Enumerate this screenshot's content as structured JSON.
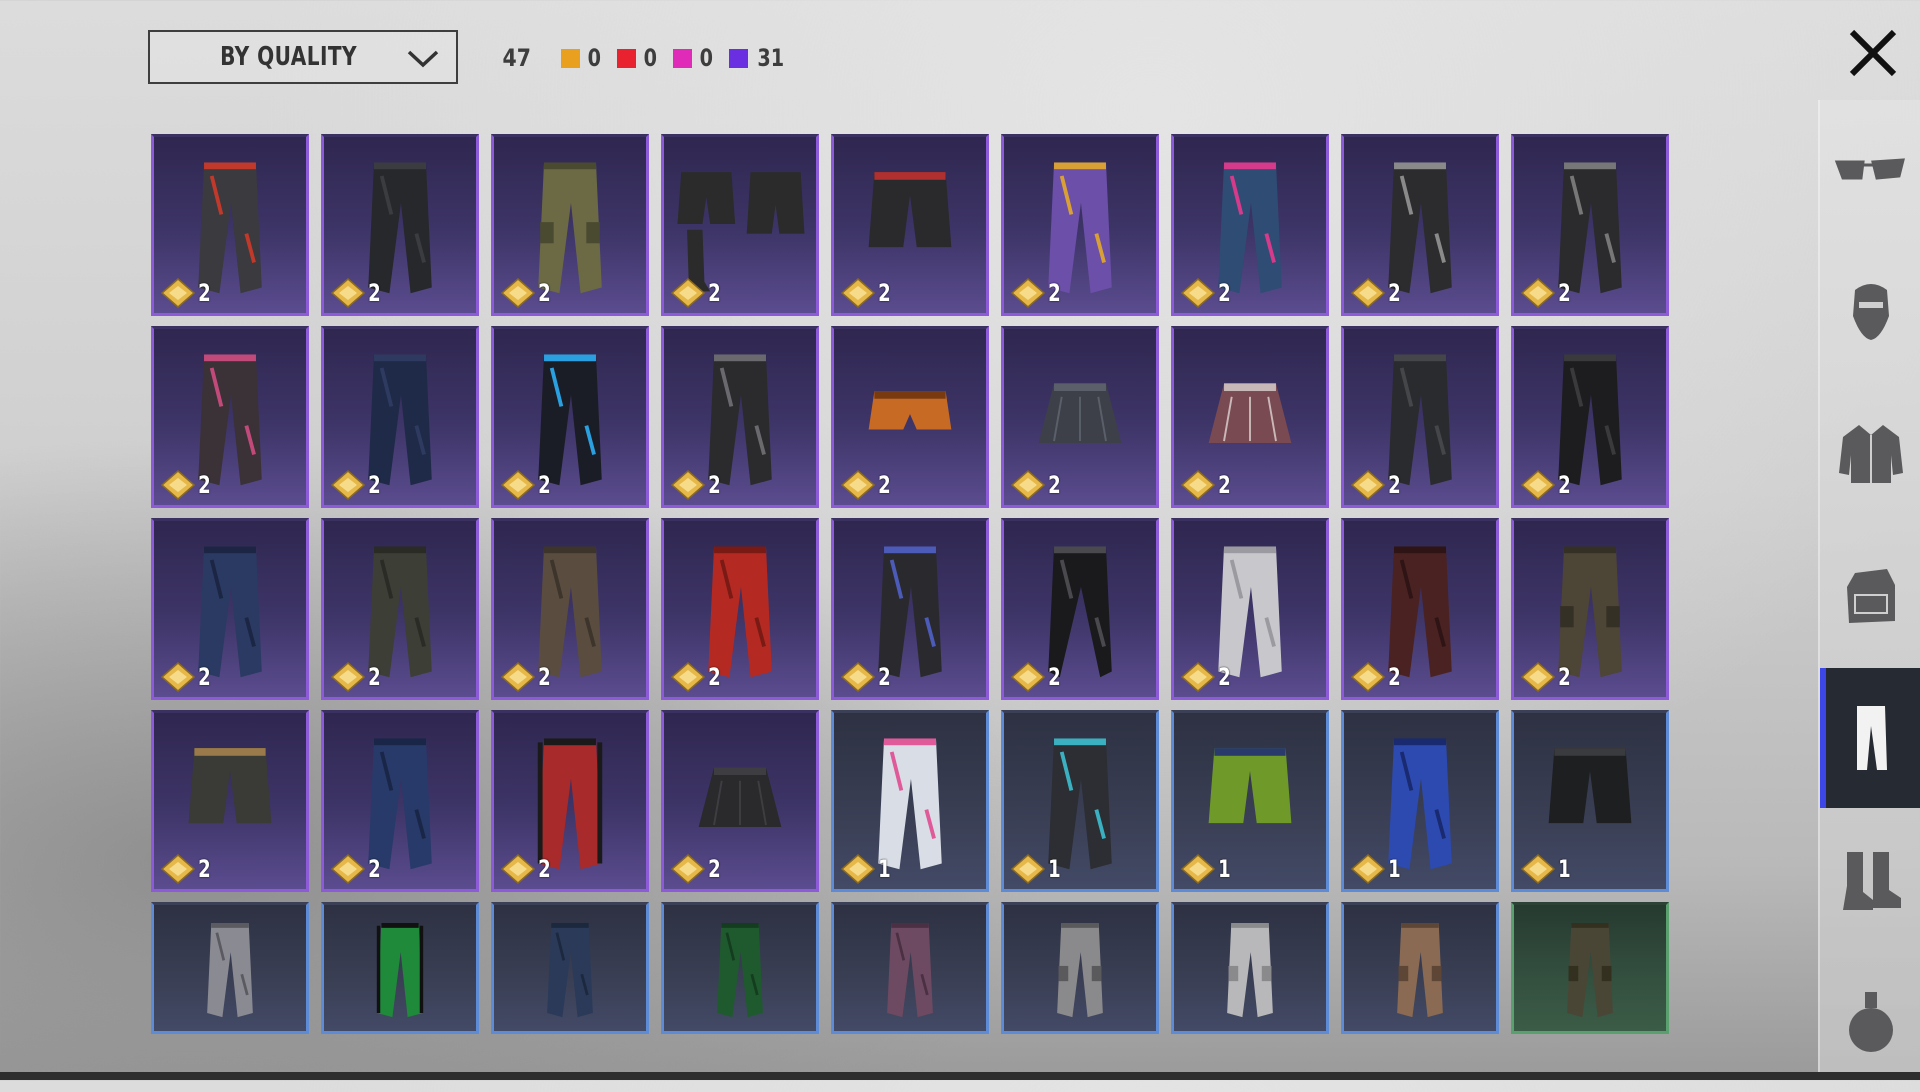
{
  "toolbar": {
    "sort_label": "BY QUALITY",
    "total_count": "47",
    "quality_counts": [
      {
        "color": "#e8a01e",
        "value": "0"
      },
      {
        "color": "#e8232f",
        "value": "0"
      },
      {
        "color": "#e02ab8",
        "value": "0"
      },
      {
        "color": "#6a2fe0",
        "value": "31"
      }
    ]
  },
  "sidebar": {
    "items": [
      {
        "icon": "glasses-icon",
        "active": false
      },
      {
        "icon": "mask-icon",
        "active": false
      },
      {
        "icon": "jacket-icon",
        "active": false
      },
      {
        "icon": "backpack-icon",
        "active": false
      },
      {
        "icon": "pants-icon",
        "active": true
      },
      {
        "icon": "boots-icon",
        "active": false
      },
      {
        "icon": "grenade-icon",
        "active": false
      }
    ]
  },
  "items": [
    {
      "quality": "epic",
      "count": "2",
      "style": "jeans",
      "color": "#3a3a3f",
      "accent": "#c0392b"
    },
    {
      "quality": "epic",
      "count": "2",
      "style": "jeans",
      "color": "#26282c",
      "accent": "#3a3c40"
    },
    {
      "quality": "epic",
      "count": "2",
      "style": "cargo",
      "color": "#6b6a45",
      "accent": "#4a4a30"
    },
    {
      "quality": "epic",
      "count": "2",
      "style": "shorts-boots",
      "color": "#2a2b2a",
      "accent": "#444"
    },
    {
      "quality": "epic",
      "count": "2",
      "style": "shorts",
      "color": "#2a2a2c",
      "accent": "#b03030"
    },
    {
      "quality": "epic",
      "count": "2",
      "style": "jeans",
      "color": "#6b4fa8",
      "accent": "#d9a036"
    },
    {
      "quality": "epic",
      "count": "2",
      "style": "jeans",
      "color": "#2f4c74",
      "accent": "#d63a8a"
    },
    {
      "quality": "epic",
      "count": "2",
      "style": "jeans",
      "color": "#2c2c2e",
      "accent": "#8a8a8a"
    },
    {
      "quality": "epic",
      "count": "2",
      "style": "jeans",
      "color": "#2b2b2e",
      "accent": "#777"
    },
    {
      "quality": "epic",
      "count": "2",
      "style": "jeans",
      "color": "#3b3238",
      "accent": "#c24a7a"
    },
    {
      "quality": "epic",
      "count": "2",
      "style": "jeans",
      "color": "#1f2a48",
      "accent": "#2e3a60"
    },
    {
      "quality": "epic",
      "count": "2",
      "style": "jeans",
      "color": "#1b1d26",
      "accent": "#2aa0e0"
    },
    {
      "quality": "epic",
      "count": "2",
      "style": "jeans",
      "color": "#2b2b2e",
      "accent": "#6a6a6e"
    },
    {
      "quality": "epic",
      "count": "2",
      "style": "briefs",
      "color": "#c66a24",
      "accent": "#7a3a10"
    },
    {
      "quality": "epic",
      "count": "2",
      "style": "skirt",
      "color": "#3d4048",
      "accent": "#5a5f6a"
    },
    {
      "quality": "epic",
      "count": "2",
      "style": "skirt",
      "color": "#7a4a52",
      "accent": "#c9b8b8"
    },
    {
      "quality": "epic",
      "count": "2",
      "style": "jeans",
      "color": "#2a2b2e",
      "accent": "#44464a"
    },
    {
      "quality": "epic",
      "count": "2",
      "style": "jeans",
      "color": "#1d1d1f",
      "accent": "#3a3a3c"
    },
    {
      "quality": "epic",
      "count": "2",
      "style": "jeans",
      "color": "#2a3a62",
      "accent": "#1c2644"
    },
    {
      "quality": "epic",
      "count": "2",
      "style": "jeans",
      "color": "#3d3e36",
      "accent": "#2a2b25"
    },
    {
      "quality": "epic",
      "count": "2",
      "style": "jeans",
      "color": "#5a4d40",
      "accent": "#3d342b"
    },
    {
      "quality": "epic",
      "count": "2",
      "style": "jeans",
      "color": "#b42a22",
      "accent": "#7a1a14"
    },
    {
      "quality": "epic",
      "count": "2",
      "style": "jeans",
      "color": "#2a2a2e",
      "accent": "#4c5ab8"
    },
    {
      "quality": "epic",
      "count": "2",
      "style": "flare",
      "color": "#1a1a1c",
      "accent": "#4a4a4e"
    },
    {
      "quality": "epic",
      "count": "2",
      "style": "jeans",
      "color": "#c8c8cc",
      "accent": "#9a9aa0"
    },
    {
      "quality": "epic",
      "count": "2",
      "style": "jeans",
      "color": "#4a2222",
      "accent": "#2e1414"
    },
    {
      "quality": "epic",
      "count": "2",
      "style": "cargo",
      "color": "#4d4535",
      "accent": "#353025"
    },
    {
      "quality": "epic",
      "count": "2",
      "style": "shorts",
      "color": "#3a3a36",
      "accent": "#9a7a4a"
    },
    {
      "quality": "epic",
      "count": "2",
      "style": "jeans",
      "color": "#283a6a",
      "accent": "#1a2648"
    },
    {
      "quality": "epic",
      "count": "2",
      "style": "track",
      "color": "#a82a2a",
      "accent": "#1a1a1a"
    },
    {
      "quality": "epic",
      "count": "2",
      "style": "skirt",
      "color": "#2a2a2c",
      "accent": "#3e3e42"
    },
    {
      "quality": "rare",
      "count": "1",
      "style": "jeans",
      "color": "#d8dde6",
      "accent": "#e05a9a"
    },
    {
      "quality": "rare",
      "count": "1",
      "style": "jeans",
      "color": "#2c2e33",
      "accent": "#3ab0c0"
    },
    {
      "quality": "rare",
      "count": "1",
      "style": "shorts",
      "color": "#6f9a2a",
      "accent": "#2a3a6a"
    },
    {
      "quality": "rare",
      "count": "1",
      "style": "jeans",
      "color": "#2c4ab0",
      "accent": "#1a2a70"
    },
    {
      "quality": "rare",
      "count": "1",
      "style": "shorts",
      "color": "#1e1f21",
      "accent": "#3a3b3e"
    },
    {
      "quality": "rare",
      "count": "",
      "style": "jeans",
      "color": "#8a8a92",
      "accent": "#5a5a60"
    },
    {
      "quality": "rare",
      "count": "",
      "style": "track",
      "color": "#1f8a3a",
      "accent": "#111"
    },
    {
      "quality": "rare",
      "count": "",
      "style": "jeans",
      "color": "#2a3a58",
      "accent": "#1c283e"
    },
    {
      "quality": "rare",
      "count": "",
      "style": "jeans",
      "color": "#1f5a2e",
      "accent": "#143d1f"
    },
    {
      "quality": "rare",
      "count": "",
      "style": "jeans",
      "color": "#6e4a62",
      "accent": "#4a3042"
    },
    {
      "quality": "rare",
      "count": "",
      "style": "cargo",
      "color": "#8a8a8c",
      "accent": "#5a5a5c"
    },
    {
      "quality": "rare",
      "count": "",
      "style": "cargo",
      "color": "#b8b8ba",
      "accent": "#8a8a8c"
    },
    {
      "quality": "rare",
      "count": "",
      "style": "cargo",
      "color": "#8a6a52",
      "accent": "#5e4636"
    },
    {
      "quality": "uncommon",
      "count": "",
      "style": "cargo",
      "color": "#4a4636",
      "accent": "#33301f"
    }
  ]
}
